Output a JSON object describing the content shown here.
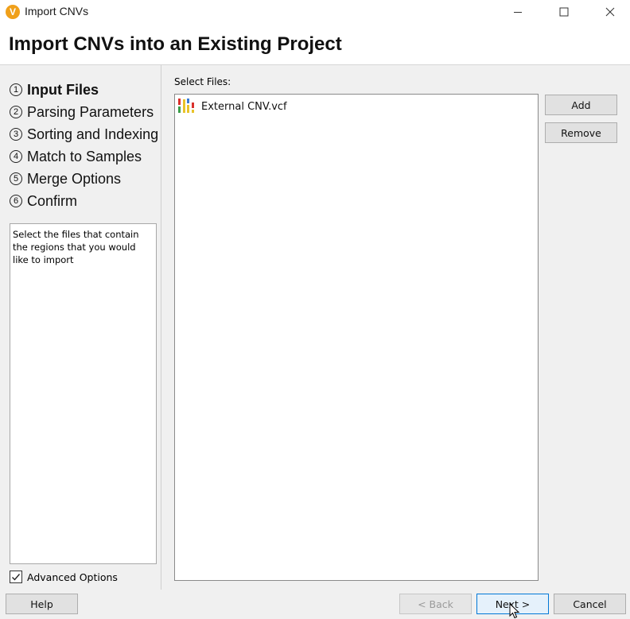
{
  "window": {
    "title": "Import CNVs",
    "logo_letter": "V",
    "accent": "#f0a01a"
  },
  "header": {
    "title": "Import CNVs into an Existing Project"
  },
  "steps": [
    {
      "num": "1",
      "label": "Input Files",
      "active": true
    },
    {
      "num": "2",
      "label": "Parsing Parameters",
      "active": false
    },
    {
      "num": "3",
      "label": "Sorting and Indexing",
      "active": false
    },
    {
      "num": "4",
      "label": "Match to Samples",
      "active": false
    },
    {
      "num": "5",
      "label": "Merge Options",
      "active": false
    },
    {
      "num": "6",
      "label": "Confirm",
      "active": false
    }
  ],
  "description": "Select the files that contain the regions that you would like to import",
  "advanced": {
    "label": "Advanced Options",
    "checked": true
  },
  "files": {
    "label": "Select Files:",
    "items": [
      {
        "name": "External CNV.vcf",
        "icon": "vcf-file-icon"
      }
    ],
    "add_label": "Add",
    "remove_label": "Remove"
  },
  "footer": {
    "help_label": "Help",
    "back_label": "< Back",
    "next_label": "Next >",
    "cancel_label": "Cancel"
  }
}
